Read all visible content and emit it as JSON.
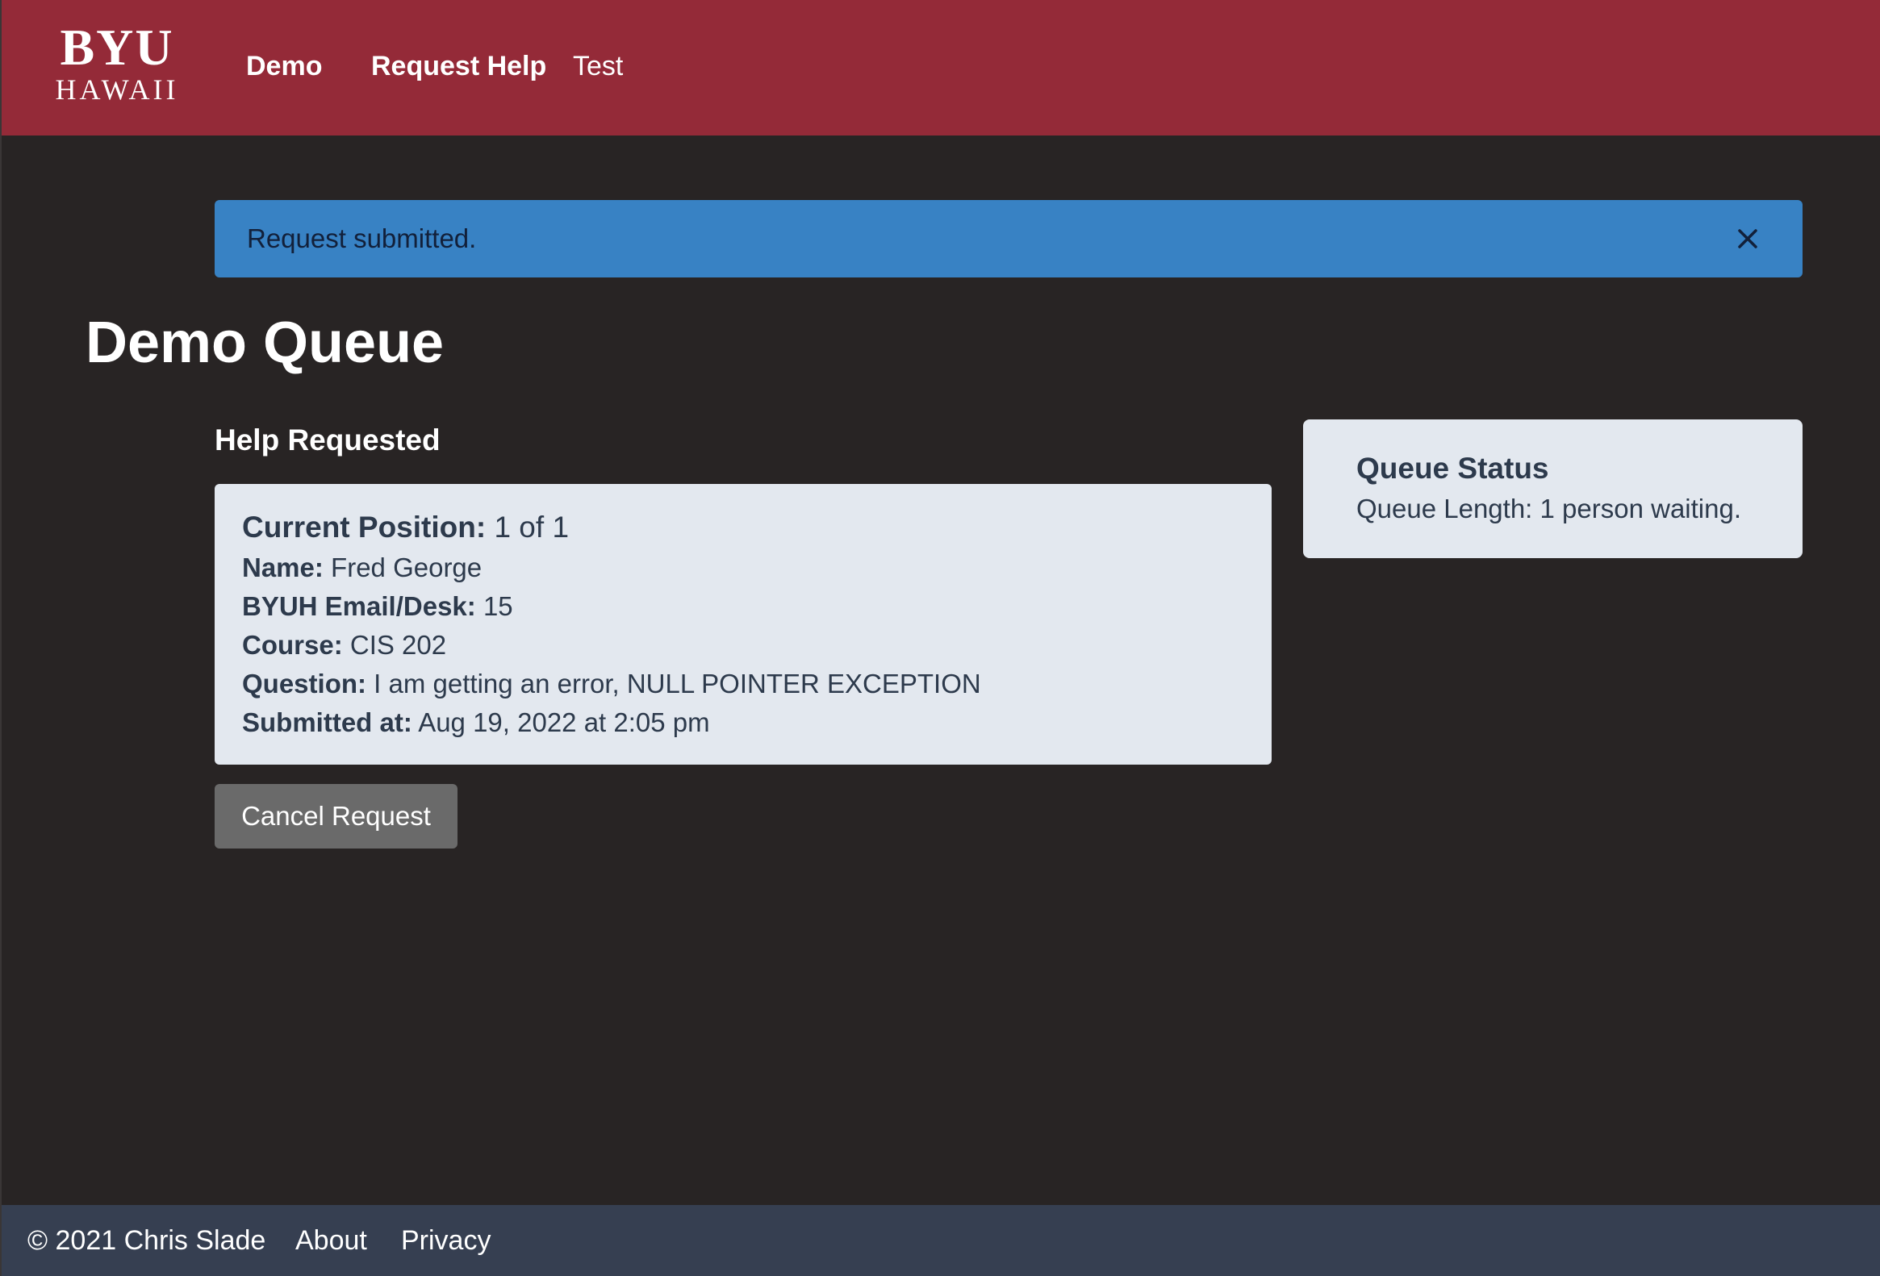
{
  "header": {
    "logo_top": "BYU",
    "logo_bottom": "HAWAII",
    "nav": {
      "demo": "Demo",
      "request_help": "Request Help",
      "test": "Test"
    },
    "background_color": "#942a38"
  },
  "alert": {
    "message": "Request submitted.",
    "close_icon": "close-icon",
    "color": "#3882c4"
  },
  "page_title": "Demo Queue",
  "help_requested": {
    "heading": "Help Requested",
    "current_position_label": "Current Position:",
    "current_position_value": "1 of 1",
    "name_label": "Name:",
    "name_value": "Fred George",
    "email_label": "BYUH Email/Desk:",
    "email_value": "15",
    "course_label": "Course:",
    "course_value": "CIS 202",
    "question_label": "Question:",
    "question_value": "I am getting an error, NULL POINTER EXCEPTION",
    "submitted_label": "Submitted at:",
    "submitted_value": "Aug 19, 2022 at 2:05 pm",
    "cancel_button": "Cancel Request"
  },
  "queue_status": {
    "title": "Queue Status",
    "length_text": "Queue Length: 1 person waiting."
  },
  "footer": {
    "copyright": "© 2021 Chris Slade",
    "about": "About",
    "privacy": "Privacy",
    "background_color": "#363f51"
  }
}
